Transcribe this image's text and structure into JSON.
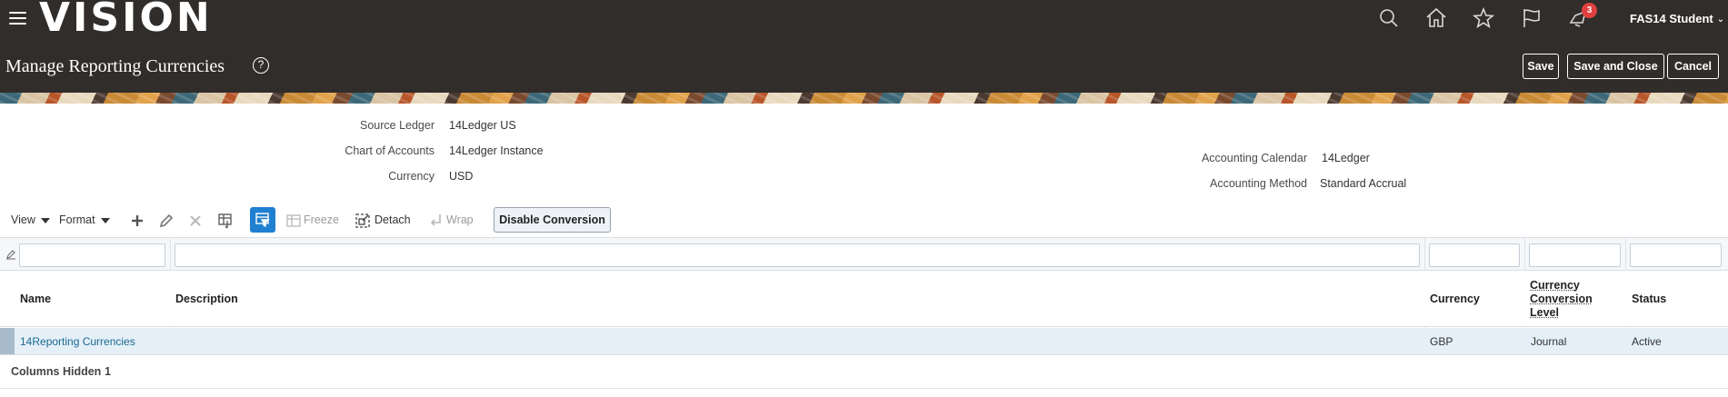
{
  "header": {
    "logo": "VISION",
    "notifications_count": "3",
    "user_name": "FAS14 Student",
    "page_title": "Manage Reporting Currencies",
    "help_glyph": "?",
    "buttons": {
      "save": "Save",
      "save_and_close": "Save and Close",
      "cancel": "Cancel"
    },
    "icons": [
      "search-icon",
      "home-icon",
      "star-icon",
      "flag-icon",
      "notifications-icon"
    ]
  },
  "ledger": {
    "source_ledger_label": "Source Ledger",
    "source_ledger_value": "14Ledger US",
    "chart_of_accounts_label": "Chart of Accounts",
    "chart_of_accounts_value": "14Ledger Instance",
    "currency_label": "Currency",
    "currency_value": "USD",
    "accounting_calendar_label": "Accounting Calendar",
    "accounting_calendar_value": "14Ledger",
    "accounting_method_label": "Accounting Method",
    "accounting_method_value": "Standard Accrual"
  },
  "toolbar": {
    "view": "View",
    "format": "Format",
    "freeze": "Freeze",
    "detach": "Detach",
    "wrap": "Wrap",
    "disable_conversion": "Disable Conversion"
  },
  "table": {
    "columns": {
      "name": "Name",
      "description": "Description",
      "currency": "Currency",
      "conversion_level_1": "Currency",
      "conversion_level_2": "Conversion",
      "conversion_level_3": "Level",
      "status": "Status"
    },
    "rows": [
      {
        "name": "14Reporting Currencies",
        "description": "",
        "currency": "GBP",
        "conversion_level": "Journal",
        "status": "Active"
      }
    ],
    "columns_hidden_label": "Columns Hidden",
    "columns_hidden_count": "1"
  },
  "colors": {
    "header_bg": "#312d2a",
    "link": "#1a6a8e",
    "selected_row": "#e4eff8",
    "accent_button": "#1f7fd0",
    "badge": "#e04040"
  }
}
